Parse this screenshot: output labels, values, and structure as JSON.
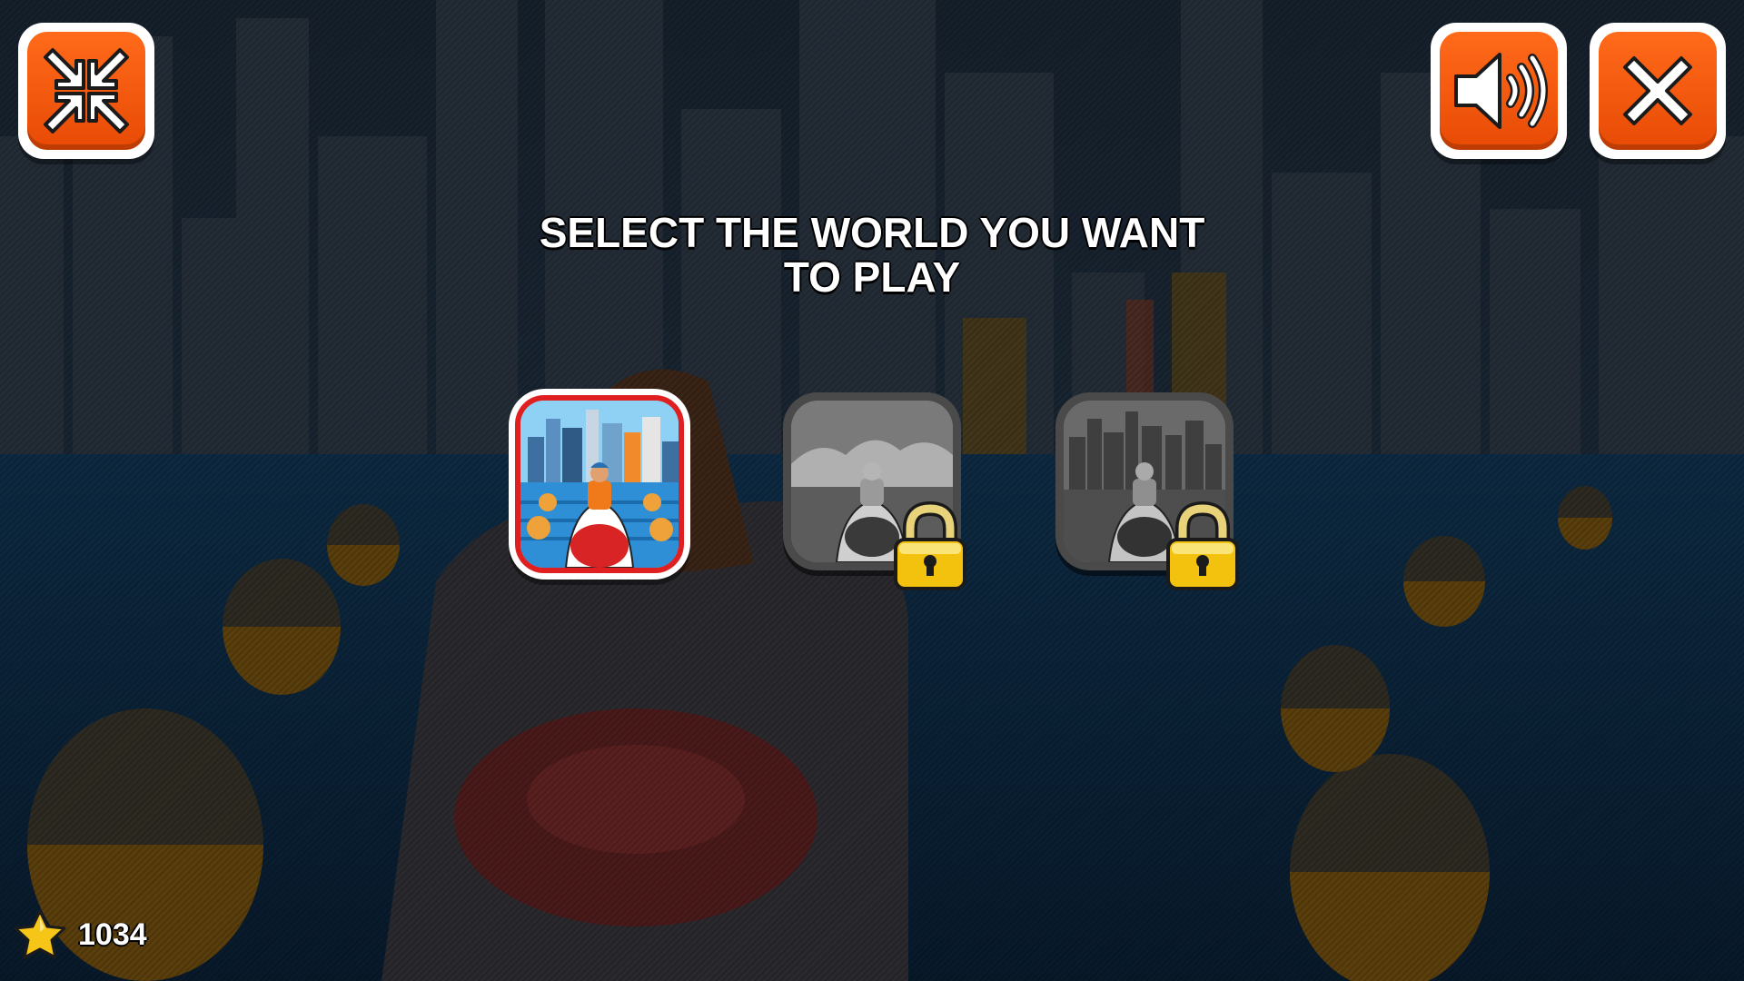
{
  "title": "SELECT THE WORLD YOU WANT TO PLAY",
  "toolbar": {
    "fullscreen_icon": "compress-arrows-icon",
    "sound_icon": "speaker-icon",
    "close_icon": "close-x-icon"
  },
  "worlds": [
    {
      "name": "city-world",
      "locked": false,
      "selected": true
    },
    {
      "name": "world-2",
      "locked": true
    },
    {
      "name": "world-3",
      "locked": true
    }
  ],
  "score": {
    "icon": "star-icon",
    "value": "1034"
  },
  "colors": {
    "button_orange": "#f05a0a",
    "button_border": "#ffffff",
    "selected_border": "#e02020",
    "lock_gold": "#f2c20f",
    "star_gold": "#f5c518"
  }
}
